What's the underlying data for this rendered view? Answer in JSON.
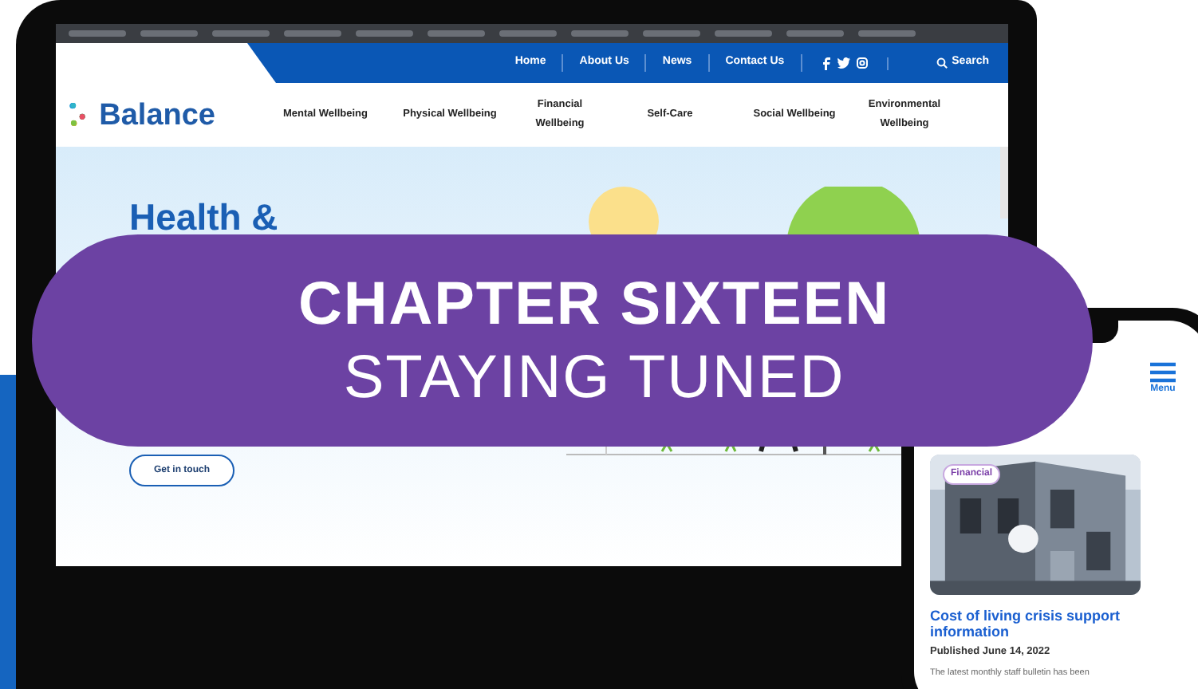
{
  "laptop": {
    "logo": "Balance",
    "nav": [
      {
        "label": "Home"
      },
      {
        "label": "About Us"
      },
      {
        "label": "News"
      },
      {
        "label": "Contact Us"
      }
    ],
    "search": "Search",
    "categories": [
      {
        "label": "Mental Wellbeing"
      },
      {
        "label": "Physical Wellbeing"
      },
      {
        "label": "Financial Wellbeing"
      },
      {
        "label": "Self-Care"
      },
      {
        "label": "Social Wellbeing"
      },
      {
        "label": "Environmental Wellbeing"
      }
    ],
    "hero": {
      "title": "Health &",
      "button": "Get in touch"
    }
  },
  "phone": {
    "menu_label": "Menu",
    "card": {
      "tag": "Financial",
      "title": "Cost of living crisis support information",
      "published": "Published June 14, 2022",
      "excerpt": "The latest monthly staff bulletin has been"
    }
  },
  "banner": {
    "lines": [
      "CHAPTER SIXTEEN",
      "STAYING TUNED"
    ]
  }
}
